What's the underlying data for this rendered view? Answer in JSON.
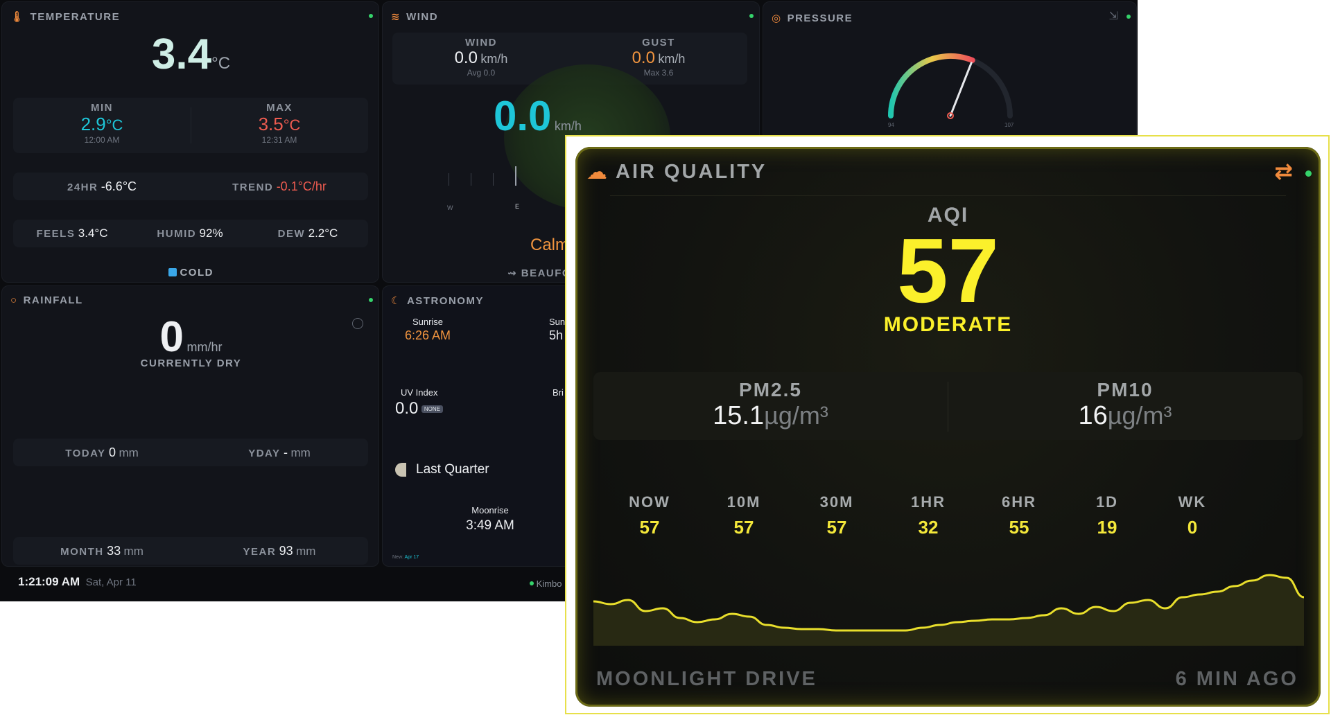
{
  "temperature": {
    "title": "TEMPERATURE",
    "current": "3.4",
    "unit": "°C",
    "min_label": "MIN",
    "min_value": "2.9",
    "min_unit": "°C",
    "min_time": "12:00 AM",
    "max_label": "MAX",
    "max_value": "3.5",
    "max_unit": "°C",
    "max_time": "12:31 AM",
    "hr24_label": "24HR",
    "hr24_value": "-6.6°C",
    "trend_label": "TREND",
    "trend_value": "-0.1°C/hr",
    "feels_label": "FEELS",
    "feels_value": "3.4°C",
    "humid_label": "HUMID",
    "humid_value": "92%",
    "dew_label": "DEW",
    "dew_value": "2.2°C",
    "status": "COLD"
  },
  "wind": {
    "title": "WIND",
    "wind_label": "WIND",
    "wind_value": "0.0",
    "wind_unit": "km/h",
    "wind_avg": "Avg 0.0",
    "gust_label": "GUST",
    "gust_value": "0.0",
    "gust_unit": "km/h",
    "gust_max": "Max 3.6",
    "speed": "0.0",
    "speed_unit": "km/h",
    "compass_w": "W",
    "compass_e": "E",
    "calm": "Calm",
    "beaufort": "BEAUFO"
  },
  "pressure": {
    "title": "PRESSURE",
    "gauge_min": "94",
    "gauge_max": "107",
    "reading_fraction": 0.62
  },
  "rainfall": {
    "title": "RAINFALL",
    "value": "0",
    "unit": "mm/hr",
    "status": "CURRENTLY DRY",
    "today_label": "TODAY",
    "today_value": "0",
    "today_unit": "mm",
    "yday_label": "YDAY",
    "yday_value": "-",
    "yday_unit": "mm",
    "month_label": "MONTH",
    "month_value": "33",
    "month_unit": "mm",
    "year_label": "YEAR",
    "year_value": "93",
    "year_unit": "mm"
  },
  "astronomy": {
    "title": "ASTRONOMY",
    "sunrise_label": "Sunrise",
    "sunrise_value": "6:26 AM",
    "sunset_label": "Sun",
    "sunset_value": "5h",
    "uv_label": "UV Index",
    "uv_value": "0.0",
    "uv_badge": "NONE",
    "bright_label": "Bri",
    "moon_phase": "Last Quarter",
    "moonrise_label": "Moonrise",
    "moonrise_value": "3:49 AM",
    "new_label": "New:",
    "new_date": "Apr 17"
  },
  "footer": {
    "time": "1:21:09 AM",
    "date": "Sat, Apr 11",
    "station": "Kimbo"
  },
  "air_quality": {
    "title": "AIR QUALITY",
    "aqi_label": "AQI",
    "aqi_value": "57",
    "category": "MODERATE",
    "pm25_label": "PM2.5",
    "pm25_value": "15.1",
    "pm25_unit": "µg/m³",
    "pm10_label": "PM10",
    "pm10_value": "16",
    "pm10_unit": "µg/m³",
    "periods": [
      {
        "label": "NOW",
        "value": "57"
      },
      {
        "label": "10M",
        "value": "57"
      },
      {
        "label": "30M",
        "value": "57"
      },
      {
        "label": "1HR",
        "value": "32"
      },
      {
        "label": "6HR",
        "value": "55"
      },
      {
        "label": "1D",
        "value": "19"
      },
      {
        "label": "WK",
        "value": "0"
      }
    ],
    "location": "MOONLIGHT DRIVE",
    "updated": "6 MIN AGO",
    "accent": "#fbf02b",
    "spark": [
      57,
      55,
      58,
      50,
      52,
      45,
      42,
      44,
      48,
      46,
      40,
      38,
      37,
      37,
      36,
      36,
      36,
      36,
      36,
      38,
      40,
      42,
      43,
      44,
      44,
      45,
      47,
      52,
      48,
      53,
      50,
      56,
      58,
      52,
      60,
      62,
      64,
      68,
      72,
      76,
      74,
      60
    ]
  }
}
